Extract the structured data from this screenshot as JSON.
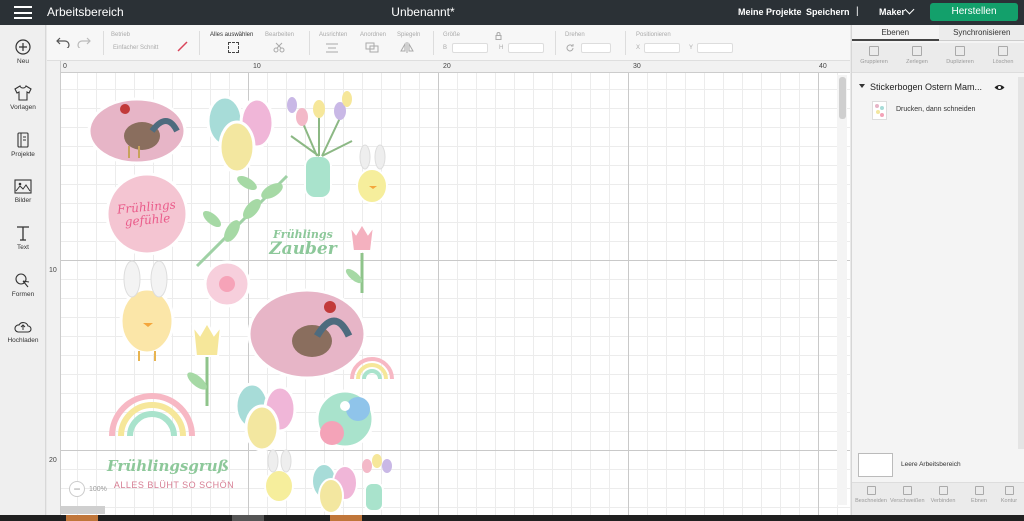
{
  "topbar": {
    "menu_icon": "hamburger-icon",
    "app_title": "Arbeitsbereich",
    "doc_title": "Unbenannt*",
    "my_projects": "Meine Projekte",
    "save": "Speichern",
    "separator": "|",
    "machine": "Maker",
    "make_button": "Herstellen",
    "make_button_color": "#13a06b"
  },
  "sidebar": {
    "items": [
      {
        "label": "Neu",
        "icon": "plus-circle-icon"
      },
      {
        "label": "Vorlagen",
        "icon": "shirt-icon"
      },
      {
        "label": "Projekte",
        "icon": "projects-icon"
      },
      {
        "label": "Bilder",
        "icon": "image-icon"
      },
      {
        "label": "Text",
        "icon": "text-icon"
      },
      {
        "label": "Formen",
        "icon": "shapes-icon"
      },
      {
        "label": "Hochladen",
        "icon": "upload-cloud-icon"
      }
    ]
  },
  "toolbar": {
    "select_all": "Alles auswählen",
    "operation_label": "Betrieb",
    "operation_value": "Einfacher Schnitt",
    "edit": "Bearbeiten",
    "align": "Ausrichten",
    "arrange": "Anordnen",
    "flip": "Spiegeln",
    "size": "Größe",
    "size_w": "B",
    "size_h": "H",
    "rotate": "Drehen",
    "position": "Positionieren",
    "pos_x": "X",
    "pos_y": "Y"
  },
  "ruler": {
    "top": [
      "0",
      "10",
      "20",
      "30",
      "40"
    ],
    "left": [
      "10",
      "20"
    ]
  },
  "canvas": {
    "zoom": "100%",
    "stickers": [
      {
        "text": "Frühlings gefühle",
        "lines": [
          "Frühlings",
          "gefühle"
        ]
      },
      {
        "text": "Frühlings Zauber",
        "lines": [
          "Frühlings",
          "Zauber"
        ]
      },
      {
        "text": "Frühlingsgruß",
        "lines": [
          "Frühlingsgruß"
        ]
      },
      {
        "text": "ALLES BLÜHT SO SCHÖN",
        "lines": [
          "ALLES BLÜHT SO SCHÖN"
        ]
      }
    ]
  },
  "right_panel": {
    "tabs": [
      "Ebenen",
      "Synchronisieren"
    ],
    "actions": [
      "Gruppieren",
      "Zerlegen",
      "Duplizieren",
      "Löschen"
    ],
    "group_name": "Stickerbogen Ostern Mam...",
    "layer_name": "Drucken, dann schneiden",
    "blank_canvas": "Leere Arbeitsbereich",
    "bottom_actions": [
      "Beschneiden",
      "Verschweißen",
      "Verbinden",
      "Ebnen",
      "Kontur"
    ]
  }
}
